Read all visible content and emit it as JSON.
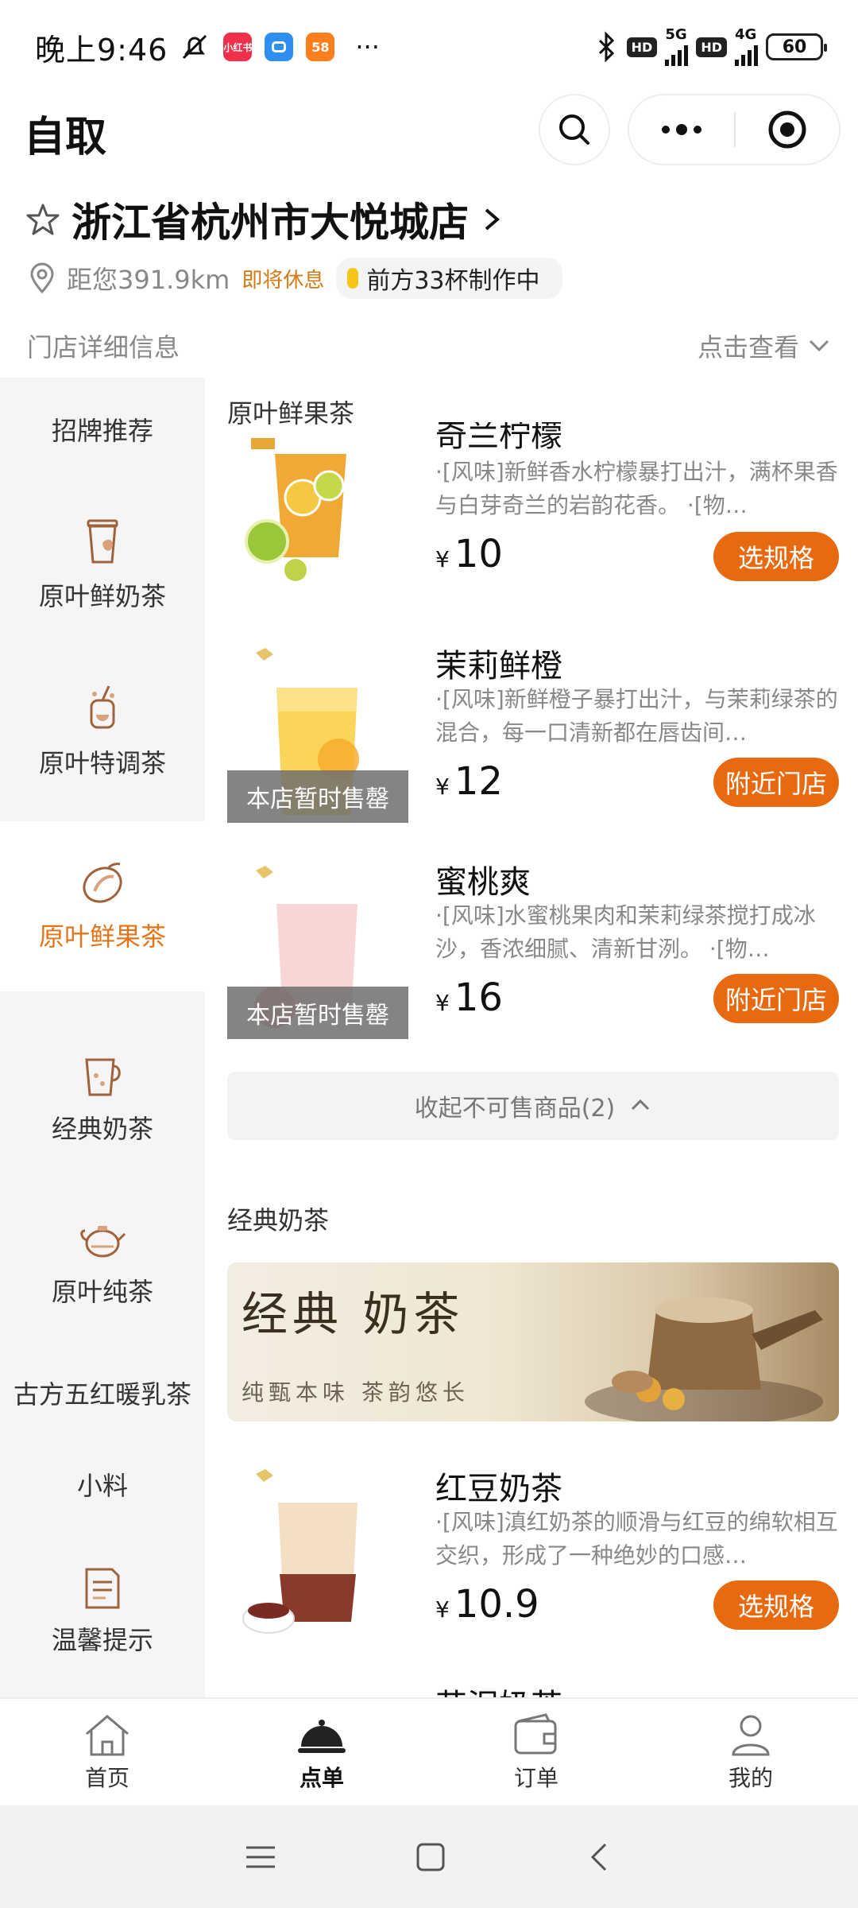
{
  "status_bar": {
    "time": "晚上9:46",
    "apps": [
      {
        "name": "小红书",
        "label": "小红书",
        "color": "#f0304a"
      },
      {
        "name": "app-blue",
        "label": "",
        "color": "#2f8ff0"
      },
      {
        "name": "58同城",
        "label": "58",
        "color": "#ff7f1e"
      }
    ],
    "more": "···",
    "net1": "5G",
    "net2": "4G",
    "hd": "HD",
    "battery": "60"
  },
  "header": {
    "title": "自取"
  },
  "store": {
    "name": "浙江省杭州市大悦城店",
    "distance": "距您391.9km",
    "status": "即将休息",
    "queue": "前方33杯制作中",
    "detail_label": "门店详细信息",
    "detail_action": "点击查看"
  },
  "sidebar": {
    "items": [
      {
        "label": "招牌推荐",
        "icon": ""
      },
      {
        "label": "原叶鲜奶茶",
        "icon": "milk-tea-cup-icon"
      },
      {
        "label": "原叶特调茶",
        "icon": "special-tea-icon"
      },
      {
        "label": "原叶鲜果茶",
        "icon": "fruit-icon"
      },
      {
        "label": "经典奶茶",
        "icon": "classic-cup-icon"
      },
      {
        "label": "原叶纯茶",
        "icon": "teapot-icon"
      },
      {
        "label": "古方五红暖乳茶",
        "icon": ""
      },
      {
        "label": "小料",
        "icon": ""
      },
      {
        "label": "温馨提示",
        "icon": "notice-doc-icon"
      }
    ],
    "active_index": 3
  },
  "content": {
    "section1_title": "原叶鲜果茶",
    "products": [
      {
        "name": "奇兰柠檬",
        "desc": "·[风味]新鲜香水柠檬暴打出汁，满杯果香与白芽奇兰的岩韵花香。 ·[物…",
        "price": "10",
        "yen": "¥",
        "button": "选规格",
        "soldout": ""
      },
      {
        "name": "茉莉鲜橙",
        "desc": "·[风味]新鲜橙子暴打出汁，与茉莉绿茶的混合，每一口清新都在唇齿间…",
        "price": "12",
        "yen": "¥",
        "button": "附近门店",
        "soldout": "本店暂时售罄"
      },
      {
        "name": "蜜桃爽",
        "desc": "·[风味]水蜜桃果肉和茉莉绿茶搅打成冰沙，香浓细腻、清新甘洌。 ·[物…",
        "price": "16",
        "yen": "¥",
        "button": "附近门店",
        "soldout": "本店暂时售罄"
      }
    ],
    "collapse_label": "收起不可售商品(2)",
    "section2_title": "经典奶茶",
    "banner_title": "经典 奶茶",
    "banner_sub": "纯甄本味 茶韵悠长",
    "product4": {
      "name": "红豆奶茶",
      "desc": "·[风味]滇红奶茶的顺滑与红豆的绵软相互交织，形成了一种绝妙的口感…",
      "price": "10.9",
      "yen": "¥",
      "button": "选规格"
    },
    "product5_partial": "芋泥奶茶"
  },
  "bottom_nav": {
    "items": [
      {
        "label": "首页",
        "icon": "home-icon"
      },
      {
        "label": "点单",
        "icon": "order-dish-icon"
      },
      {
        "label": "订单",
        "icon": "wallet-icon"
      },
      {
        "label": "我的",
        "icon": "profile-icon"
      }
    ],
    "active_index": 1
  },
  "colors": {
    "accent": "#e86a10",
    "active_text": "#e4741a",
    "sidebar_bg": "#f5f5f5"
  }
}
